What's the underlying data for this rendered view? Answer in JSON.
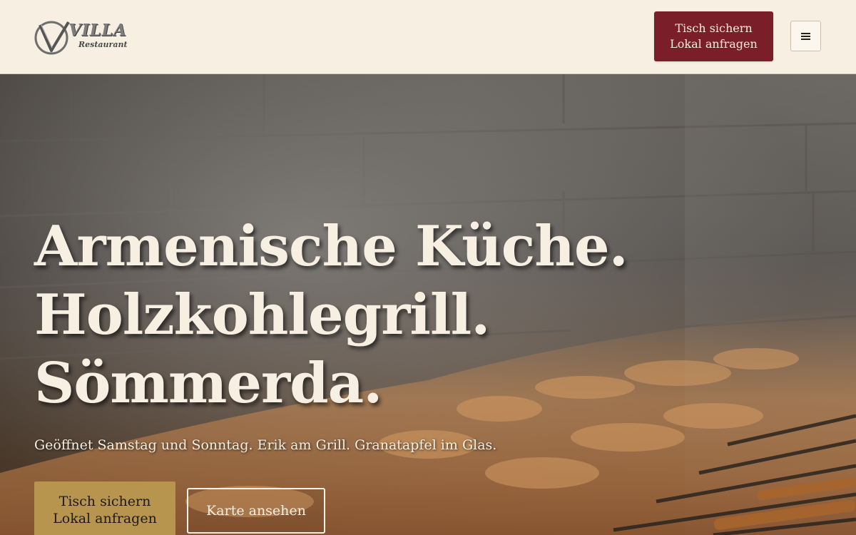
{
  "brand": {
    "name": "VILLA",
    "subtitle": "Restaurant"
  },
  "header": {
    "cta_line1": "Tisch sichern",
    "cta_line2": "Lokal anfragen",
    "menu_icon": "hamburger-menu-icon"
  },
  "hero": {
    "headline": [
      "Armenische Küche.",
      "Holzkohlegrill.",
      "Sömmerda."
    ],
    "tagline": "Geöffnet Samstag und Sonntag. Erik am Grill. Granatapfel im Glas.",
    "primary_line1": "Tisch sichern",
    "primary_line2": "Lokal anfragen",
    "secondary": "Karte ansehen"
  },
  "colors": {
    "header_bg": "#f7efe2",
    "cta_red": "#7a1f2a",
    "gold": "#b8954f",
    "cream_text": "#f7efe2"
  }
}
